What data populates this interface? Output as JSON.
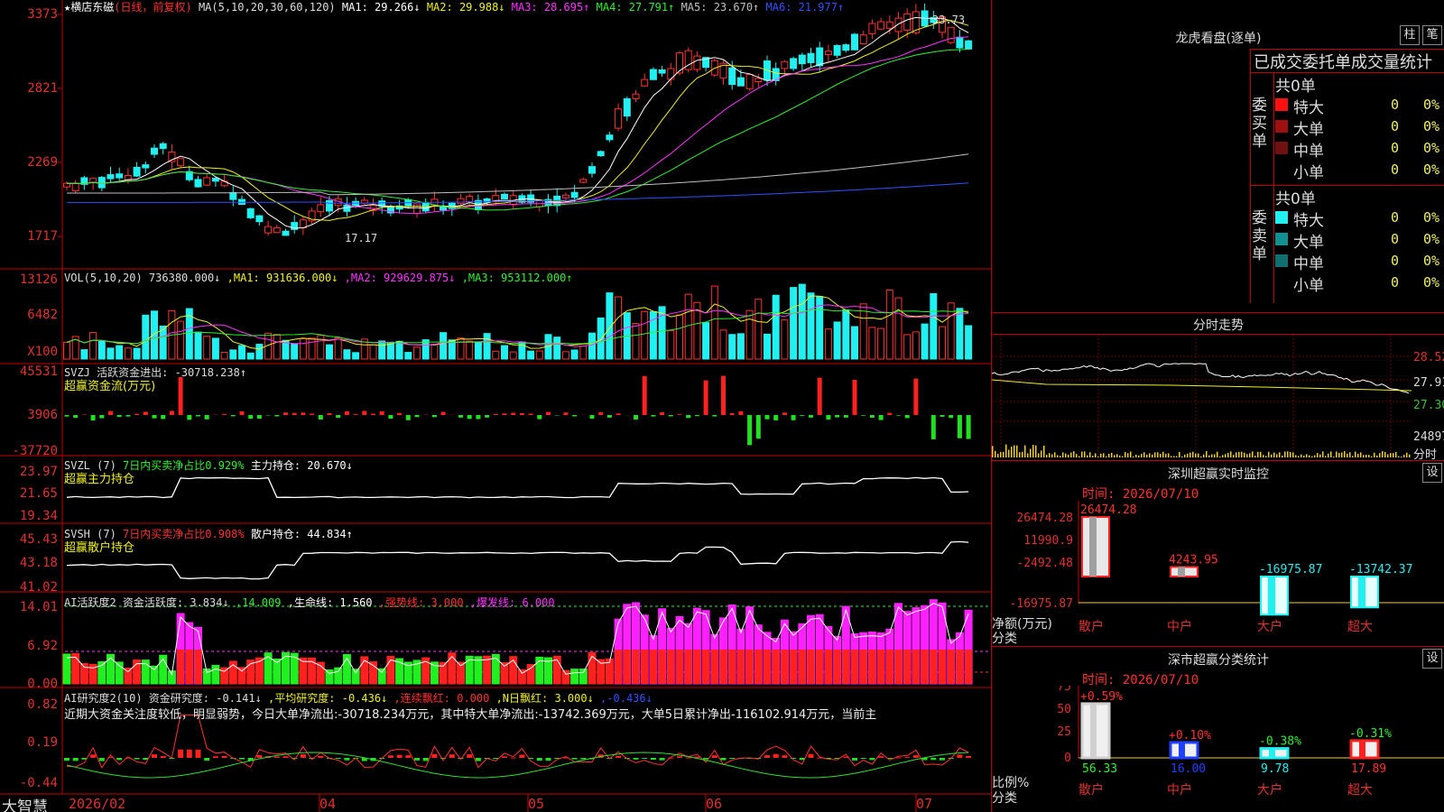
{
  "app": {
    "brand": "大智慧"
  },
  "stock": {
    "star": "★",
    "name": "横店东磁",
    "mode": "(日线，前复权)"
  },
  "ma": {
    "label": "MA(5,10,20,30,60,120)",
    "items": [
      {
        "text": "MA1: 29.266↓",
        "color": "#ffffff"
      },
      {
        "text": "MA2: 29.988↓",
        "color": "#f0f020"
      },
      {
        "text": "MA3: 28.695↑",
        "color": "#ff30ff"
      },
      {
        "text": "MA4: 27.791↑",
        "color": "#30f030"
      },
      {
        "text": "MA5: 23.670↑",
        "color": "#c0c0c0"
      },
      {
        "text": "MA6: 21.977↑",
        "color": "#3050ff"
      }
    ],
    "high_label": "33.73",
    "low_label": "17.17"
  },
  "price_axis": [
    "3373",
    "2821",
    "2269",
    "1717"
  ],
  "vol": {
    "head": "VOL(5,10,20) 736380.000↓",
    "items": [
      {
        "text": "MA1: 931636.000↓",
        "color": "#f0f020"
      },
      {
        "text": "MA2: 929629.875↓",
        "color": "#ff30ff"
      },
      {
        "text": "MA3: 953112.000↑",
        "color": "#30f030"
      }
    ],
    "axis": [
      "13126",
      "6482"
    ],
    "unit": "X100"
  },
  "svzj": {
    "head": "SVZJ  活跃资金进出: -30718.238↑",
    "sub": "超赢资金流(万元)",
    "axis": [
      "45531",
      "3906",
      "-37720"
    ]
  },
  "svzl": {
    "head": "SVZL (7)",
    "mid": "7日内买卖净占比0.929%",
    "tail": "主力持仓: 20.670↓",
    "sub": "超赢主力持仓",
    "axis": [
      "23.97",
      "21.65",
      "19.34"
    ]
  },
  "svsh": {
    "head": "SVSH (7)",
    "mid": "7日内买卖净占比0.908%",
    "tail": "散户持仓: 44.834↑",
    "sub": "超赢散户持仓",
    "axis": [
      "45.43",
      "43.18",
      "41.02"
    ]
  },
  "ai2": {
    "head": "AI活跃度2 资金活跃度: 3.834↓",
    "items": [
      {
        "text": "14.009",
        "color": "#30f030"
      },
      {
        "text": "生命线: 1.560",
        "color": "#ffffff"
      },
      {
        "text": "强势线: 3.000",
        "color": "#ff3030"
      },
      {
        "text": "爆发线: 6.000",
        "color": "#ff30ff"
      }
    ],
    "axis": [
      "14.01",
      "6.92",
      "0.00"
    ]
  },
  "yan": {
    "head": "AI研究度2(10) 资金研究度: -0.141↓",
    "items": [
      {
        "text": "平均研究度: -0.436↓",
        "color": "#f0f020"
      },
      {
        "text": "连续飘红: 0.000",
        "color": "#ff3030"
      },
      {
        "text": "N日飘红: 3.000↓",
        "color": "#f0f020"
      },
      {
        "text": "-0.436↓",
        "color": "#3050ff"
      }
    ],
    "note": "近期大资金关注度较低，明显弱势，今日大单净流出:-30718.234万元，其中特大单净流出:-13742.369万元，大单5日累计净出-116102.914万元，当前主",
    "axis": [
      "0.82",
      "0.19",
      "-0.44"
    ]
  },
  "dates": [
    "2026/02",
    "04",
    "05",
    "06",
    "07"
  ],
  "longhu": {
    "title": "龙虎看盘(逐单)",
    "btn1": "柱",
    "btn2": "笔",
    "tabs": "已成交委托单成交量统计",
    "buy": {
      "side": "委买单",
      "total": "共0单",
      "rows": [
        {
          "name": "特大",
          "val": "0",
          "pct": "0%",
          "color": "#ff1010"
        },
        {
          "name": "大单",
          "val": "0",
          "pct": "0%",
          "color": "#a01010"
        },
        {
          "name": "中单",
          "val": "0",
          "pct": "0%",
          "color": "#701010"
        },
        {
          "name": "小单",
          "val": "0",
          "pct": "0%",
          "color": ""
        }
      ]
    },
    "sell": {
      "side": "委卖单",
      "total": "共0单",
      "rows": [
        {
          "name": "特大",
          "val": "0",
          "pct": "0%",
          "color": "#20f0f0"
        },
        {
          "name": "大单",
          "val": "0",
          "pct": "0%",
          "color": "#109090"
        },
        {
          "name": "中单",
          "val": "0",
          "pct": "0%",
          "color": "#107070"
        },
        {
          "name": "小单",
          "val": "0",
          "pct": "0%",
          "color": ""
        }
      ]
    }
  },
  "fenshi": {
    "title": "分时走势",
    "axis": [
      "28.52",
      "27.91",
      "27.30"
    ],
    "vol": "24897",
    "unit": "分时"
  },
  "monitor": {
    "title": "深圳超赢实时监控",
    "btn": "设",
    "time": "时间: 2026/07/10",
    "axis": [
      "26474.28",
      "11990.9",
      "-2492.48",
      "-16975.87"
    ],
    "unit": "净额(万元)",
    "fenlei": "分类",
    "bars": [
      {
        "cat": "散户",
        "label": "26474.28",
        "value": 26474.28
      },
      {
        "cat": "中户",
        "label": "4243.95",
        "value": 4243.95
      },
      {
        "cat": "大户",
        "label": "-16975.87",
        "value": -16975.87
      },
      {
        "cat": "超大",
        "label": "-13742.37",
        "value": -13742.37
      }
    ]
  },
  "classify": {
    "title": "深市超赢分类统计",
    "btn": "设",
    "time": "时间: 2026/07/10",
    "axis": [
      "75",
      "50",
      "25",
      "0"
    ],
    "unit": "比例%",
    "fenlei": "分类",
    "bars": [
      {
        "cat": "散户",
        "top": "+0.59%",
        "bottom": "56.33",
        "value": 56.33,
        "color": "#d0d0d0",
        "tcolor": "#ff3030"
      },
      {
        "cat": "中户",
        "top": "+0.10%",
        "bottom": "16.00",
        "value": 16.0,
        "color": "#2040ff",
        "tcolor": "#ff3030"
      },
      {
        "cat": "大户",
        "top": "-0.38%",
        "bottom": "9.78",
        "value": 9.78,
        "color": "#20f0f0",
        "tcolor": "#30f030"
      },
      {
        "cat": "超大",
        "top": "-0.31%",
        "bottom": "17.89",
        "value": 17.89,
        "color": "#ff2020",
        "tcolor": "#30f030"
      }
    ]
  },
  "chart_data": [
    {
      "type": "candlestick",
      "title": "横店东磁 (日线，前复权)",
      "y_axis_ticks": [
        3373,
        2821,
        2269,
        1717
      ],
      "high": 33.73,
      "low": 17.17,
      "x_labels": [
        "2026/02",
        "04",
        "05",
        "06",
        "07"
      ],
      "series": [
        "MA1",
        "MA2",
        "MA3",
        "MA4",
        "MA5",
        "MA6"
      ]
    },
    {
      "type": "bar",
      "title": "VOL(5,10,20)",
      "y_axis_ticks": [
        13126,
        6482
      ],
      "last": 736380.0
    },
    {
      "type": "bar",
      "title": "SVZJ 活跃资金进出",
      "y_axis_ticks": [
        45531,
        3906,
        -37720
      ],
      "last": -30718.238
    },
    {
      "type": "line",
      "title": "SVZL (7) 主力持仓",
      "y_axis_ticks": [
        23.97,
        21.65,
        19.34
      ],
      "last": 20.67
    },
    {
      "type": "line",
      "title": "SVSH (7) 散户持仓",
      "y_axis_ticks": [
        45.43,
        43.18,
        41.02
      ],
      "last": 44.834
    },
    {
      "type": "bar",
      "title": "AI活跃度2",
      "y_axis_ticks": [
        14.01,
        6.92,
        0.0
      ],
      "last": 3.834
    },
    {
      "type": "bar",
      "title": "AI研究度2(10)",
      "y_axis_ticks": [
        0.82,
        0.19,
        -0.44
      ],
      "last": -0.141
    },
    {
      "type": "bar",
      "title": "深圳超赢实时监控",
      "categories": [
        "散户",
        "中户",
        "大户",
        "超大"
      ],
      "values": [
        26474.28,
        4243.95,
        -16975.87,
        -13742.37
      ],
      "ylabel": "净额(万元)"
    },
    {
      "type": "bar",
      "title": "深市超赢分类统计",
      "categories": [
        "散户",
        "中户",
        "大户",
        "超大"
      ],
      "values": [
        56.33,
        16.0,
        9.78,
        17.89
      ],
      "changes": [
        "+0.59%",
        "+0.10%",
        "-0.38%",
        "-0.31%"
      ],
      "ylabel": "比例%",
      "ylim": [
        0,
        75
      ]
    }
  ]
}
